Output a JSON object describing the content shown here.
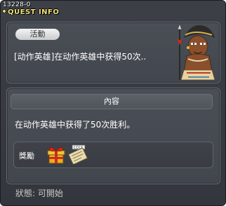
{
  "window": {
    "id_label": "13228-0",
    "title": "QUEST INFO"
  },
  "quest": {
    "category_label": "活動",
    "name": "[动作英雄]在动作英雄中获得50次..",
    "npc_icon": "tribal-warrior-npc-icon"
  },
  "content": {
    "header": "內容",
    "description": "在动作英雄中获得了50次胜利。"
  },
  "reward": {
    "label": "獎勵",
    "items": [
      {
        "icon": "gift-box-icon"
      },
      {
        "icon": "exp-scroll-icon",
        "badge": "CCCC"
      }
    ]
  },
  "status": {
    "text": "狀態:  可開始"
  },
  "colors": {
    "title": "#f2e27a",
    "window_bg": "#3c4046",
    "panel_bg": "#4a4f56"
  }
}
